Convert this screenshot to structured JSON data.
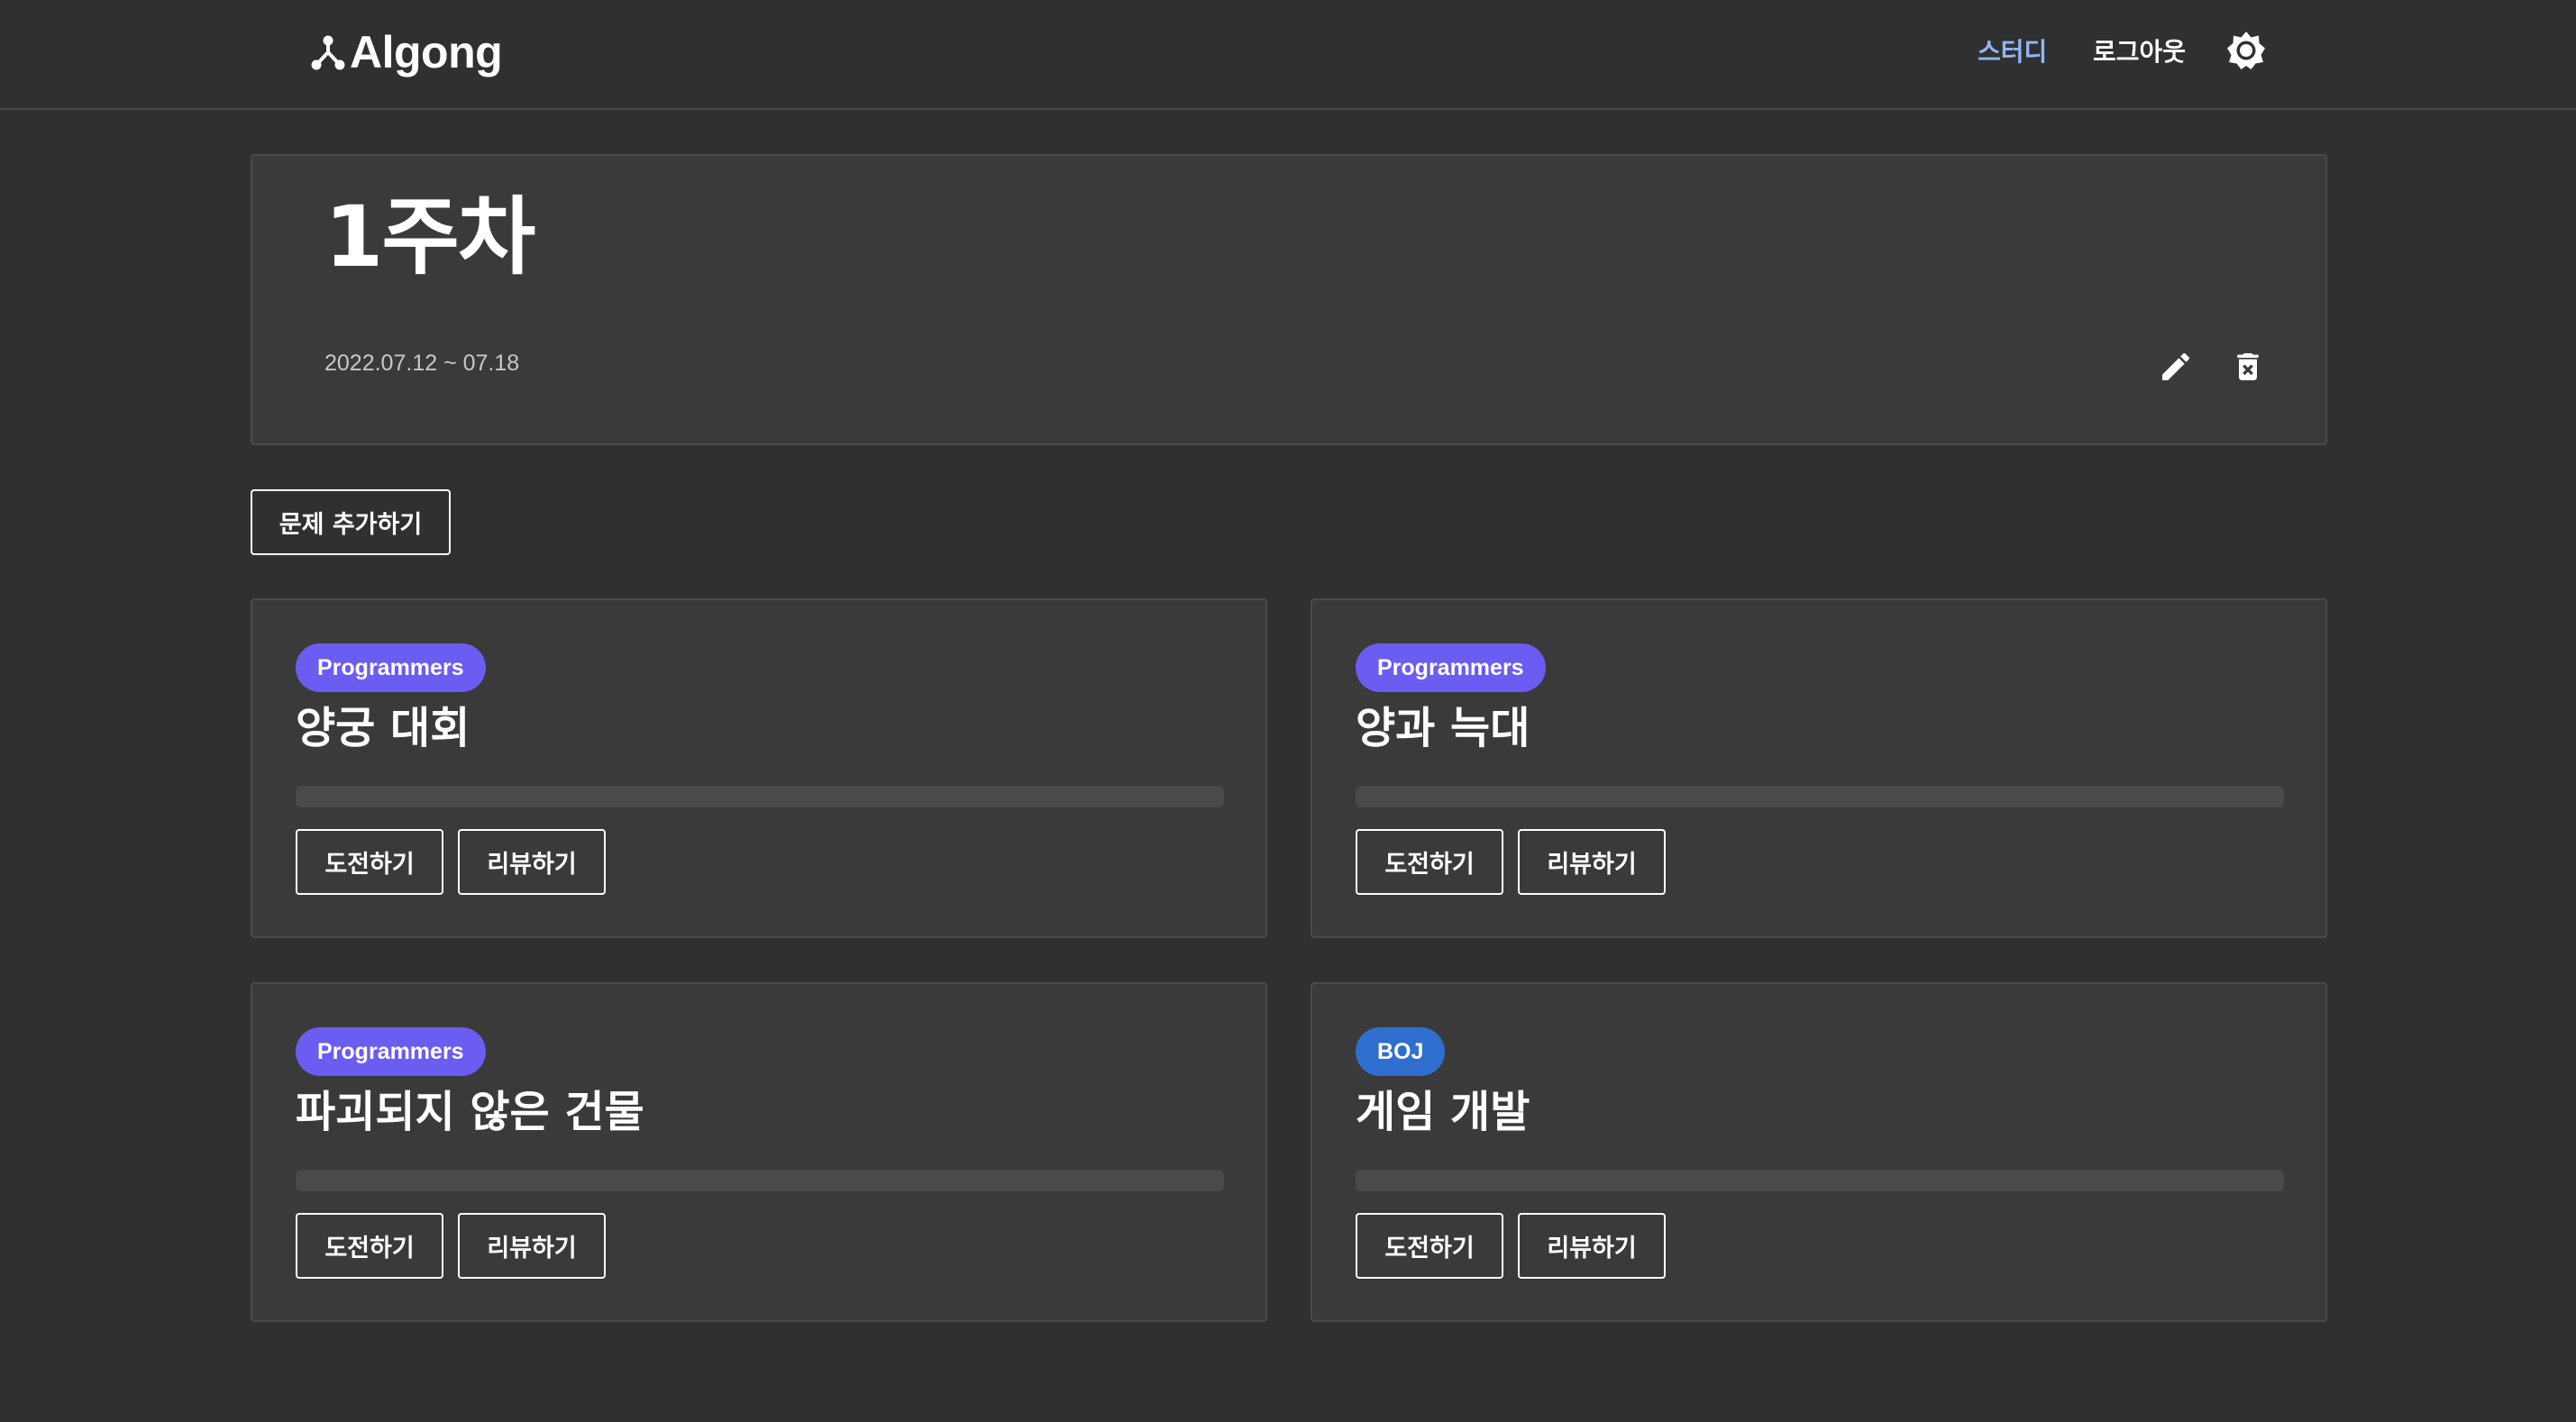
{
  "header": {
    "logo_text": "Algong",
    "logo_icon": "branch-icon",
    "nav_study": "스터디",
    "nav_logout": "로그아웃",
    "theme_icon": "sun-icon",
    "study_link_color": "#8fb7f5"
  },
  "week": {
    "title": "1주차",
    "dates": "2022.07.12 ~ 07.18",
    "edit_icon": "pencil-icon",
    "delete_icon": "trash-x-icon"
  },
  "add_problem_label": "문제 추가하기",
  "problems": [
    {
      "platform": "Programmers",
      "title": "양궁 대회",
      "progress": 0,
      "challenge_label": "도전하기",
      "review_label": "리뷰하기"
    },
    {
      "platform": "Programmers",
      "title": "양과 늑대",
      "progress": 0,
      "challenge_label": "도전하기",
      "review_label": "리뷰하기"
    },
    {
      "platform": "Programmers",
      "title": "파괴되지 않은 건물",
      "progress": 0,
      "challenge_label": "도전하기",
      "review_label": "리뷰하기"
    },
    {
      "platform": "BOJ",
      "title": "게임 개발",
      "progress": 0,
      "challenge_label": "도전하기",
      "review_label": "리뷰하기"
    }
  ],
  "colors": {
    "background": "#303030",
    "panel": "#3a3a3a",
    "programmers_badge": "#6b5cf2",
    "boj_badge": "#2f6fd0"
  }
}
